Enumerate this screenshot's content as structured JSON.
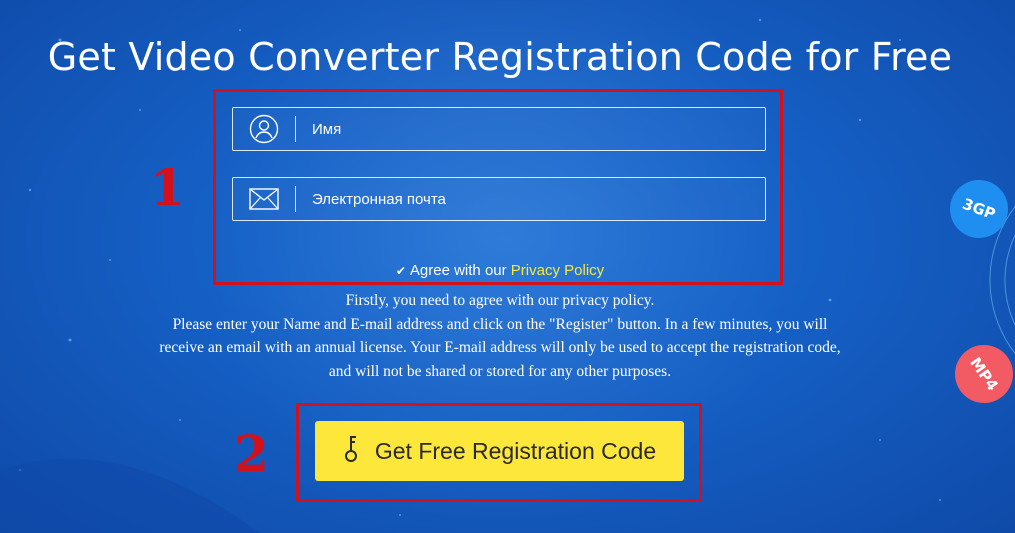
{
  "header": {
    "title": "Get Video Converter Registration Code for Free"
  },
  "annotations": {
    "step1": "1",
    "step2": "2"
  },
  "form": {
    "name_placeholder": "Имя",
    "email_placeholder": "Электронная почта",
    "agree_text": "Agree with our",
    "privacy_link": "Privacy Policy",
    "checkbox_checked": true
  },
  "info": {
    "line1": "Firstly, you need to agree with our privacy policy.",
    "line2": "Please enter your Name and E-mail address and click on the \"Register\" button. In a few minutes, you will receive an email with an annual license. Your E-mail address will only be used to accept the registration code, and will not be shared or stored for any other purposes."
  },
  "cta": {
    "label": "Get Free Registration Code"
  },
  "decor": {
    "badge_3gp": "3GP",
    "badge_mp4": "MP4"
  },
  "colors": {
    "background": "#155fc4",
    "accent_link": "#f8ea3a",
    "button": "#fde73a",
    "annotation_red": "#d2111d"
  }
}
